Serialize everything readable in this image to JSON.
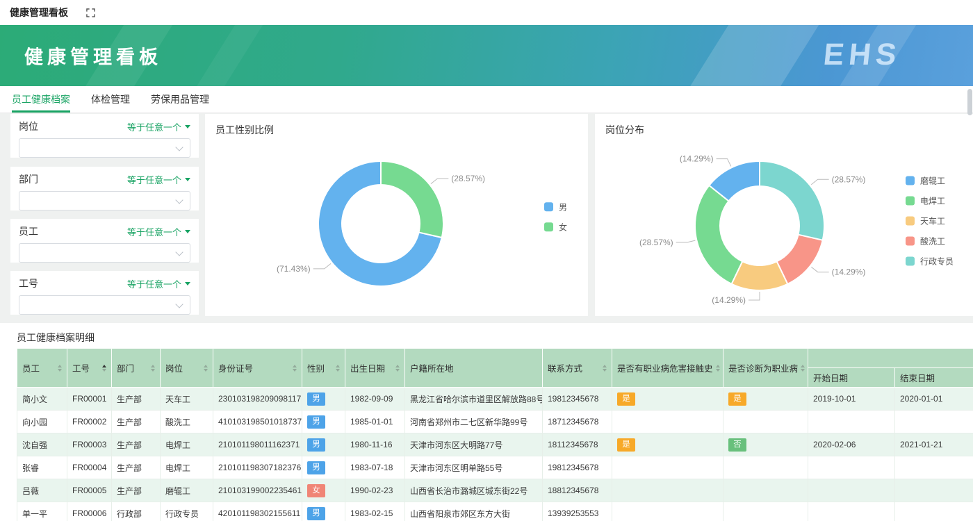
{
  "titlebar": {
    "title": "健康管理看板"
  },
  "banner": {
    "title": "健康管理看板",
    "logo": "EHS"
  },
  "tabs": [
    {
      "id": "employee-health-archive",
      "label": "员工健康档案",
      "active": true
    },
    {
      "id": "checkup-management",
      "label": "体检管理",
      "active": false
    },
    {
      "id": "ppe-management",
      "label": "劳保用品管理",
      "active": false
    }
  ],
  "filters": [
    {
      "id": "position",
      "label": "岗位",
      "operator": "等于任意一个",
      "value": ""
    },
    {
      "id": "department",
      "label": "部门",
      "operator": "等于任意一个",
      "value": ""
    },
    {
      "id": "employee",
      "label": "员工",
      "operator": "等于任意一个",
      "value": ""
    },
    {
      "id": "employee-no",
      "label": "工号",
      "operator": "等于任意一个",
      "value": ""
    }
  ],
  "chart_data": [
    {
      "type": "pie",
      "title": "员工性别比例",
      "labels": [
        "男",
        "女"
      ],
      "values": [
        71.43,
        28.57
      ],
      "colors": [
        "#63b2ee",
        "#76da91"
      ],
      "donut": true,
      "start_angle": 90,
      "counterclockwise": true,
      "legend_position": "right",
      "label_format": "(percent%)"
    },
    {
      "type": "pie",
      "title": "岗位分布",
      "labels": [
        "磨辊工",
        "电焊工",
        "天车工",
        "酸洗工",
        "行政专员"
      ],
      "values": [
        14.29,
        28.57,
        14.29,
        14.29,
        28.57
      ],
      "colors": [
        "#63b2ee",
        "#76da91",
        "#f8cb7f",
        "#f89588",
        "#7cd6cf"
      ],
      "donut": true,
      "start_angle": 90,
      "counterclockwise": true,
      "legend_position": "right",
      "label_format": "(percent%)"
    }
  ],
  "badge_colors": {
    "blue": "#4da3e8",
    "red": "#f08576",
    "orange": "#f7a928",
    "green": "#68c07c"
  },
  "table": {
    "title": "员工健康档案明细",
    "columns": [
      {
        "label": "员工",
        "sortable": true,
        "sort": null
      },
      {
        "label": "工号",
        "sortable": true,
        "sort": "asc"
      },
      {
        "label": "部门",
        "sortable": true,
        "sort": null
      },
      {
        "label": "岗位",
        "sortable": true,
        "sort": null
      },
      {
        "label": "身份证号",
        "sortable": true,
        "sort": null
      },
      {
        "label": "性别",
        "sortable": true,
        "sort": null
      },
      {
        "label": "出生日期",
        "sortable": true,
        "sort": null
      },
      {
        "label": "户籍所在地",
        "sortable": false,
        "sort": null
      },
      {
        "label": "联系方式",
        "sortable": true,
        "sort": null
      },
      {
        "label": "是否有职业病危害接触史",
        "sortable": true,
        "sort": null
      },
      {
        "label": "是否诊断为职业病",
        "sortable": true,
        "sort": null
      },
      {
        "label": "开始日期",
        "sortable": false,
        "sort": null,
        "group": true
      },
      {
        "label": "结束日期",
        "sortable": false,
        "sort": null,
        "group": true
      }
    ],
    "rows": [
      [
        "简小文",
        "FR00001",
        "生产部",
        "天车工",
        "230103198209098117",
        {
          "text": "男",
          "color": "blue"
        },
        "1982-09-09",
        "黑龙江省哈尔滨市道里区解放路88号",
        "19812345678",
        {
          "text": "是",
          "color": "orange"
        },
        {
          "text": "是",
          "color": "orange"
        },
        "2019-10-01",
        "2020-01-01"
      ],
      [
        "向小园",
        "FR00002",
        "生产部",
        "酸洗工",
        "410103198501018737",
        {
          "text": "男",
          "color": "blue"
        },
        "1985-01-01",
        "河南省郑州市二七区新华路99号",
        "18712345678",
        "",
        "",
        "",
        ""
      ],
      [
        "沈自强",
        "FR00003",
        "生产部",
        "电焊工",
        "210101198011162371",
        {
          "text": "男",
          "color": "blue"
        },
        "1980-11-16",
        "天津市河东区大明路77号",
        "18112345678",
        {
          "text": "是",
          "color": "orange"
        },
        {
          "text": "否",
          "color": "green"
        },
        "2020-02-06",
        "2021-01-21"
      ],
      [
        "张睿",
        "FR00004",
        "生产部",
        "电焊工",
        "210101198307182376",
        {
          "text": "男",
          "color": "blue"
        },
        "1983-07-18",
        "天津市河东区明单路55号",
        "19812345678",
        "",
        "",
        "",
        ""
      ],
      [
        "吕薇",
        "FR00005",
        "生产部",
        "磨辊工",
        "210103199002235461",
        {
          "text": "女",
          "color": "red"
        },
        "1990-02-23",
        "山西省长治市潞城区城东街22号",
        "18812345678",
        "",
        "",
        "",
        ""
      ],
      [
        "单一平",
        "FR00006",
        "行政部",
        "行政专员",
        "420101198302155611",
        {
          "text": "男",
          "color": "blue"
        },
        "1983-02-15",
        "山西省阳泉市郊区东方大街",
        "13939253553",
        "",
        "",
        "",
        ""
      ]
    ]
  }
}
